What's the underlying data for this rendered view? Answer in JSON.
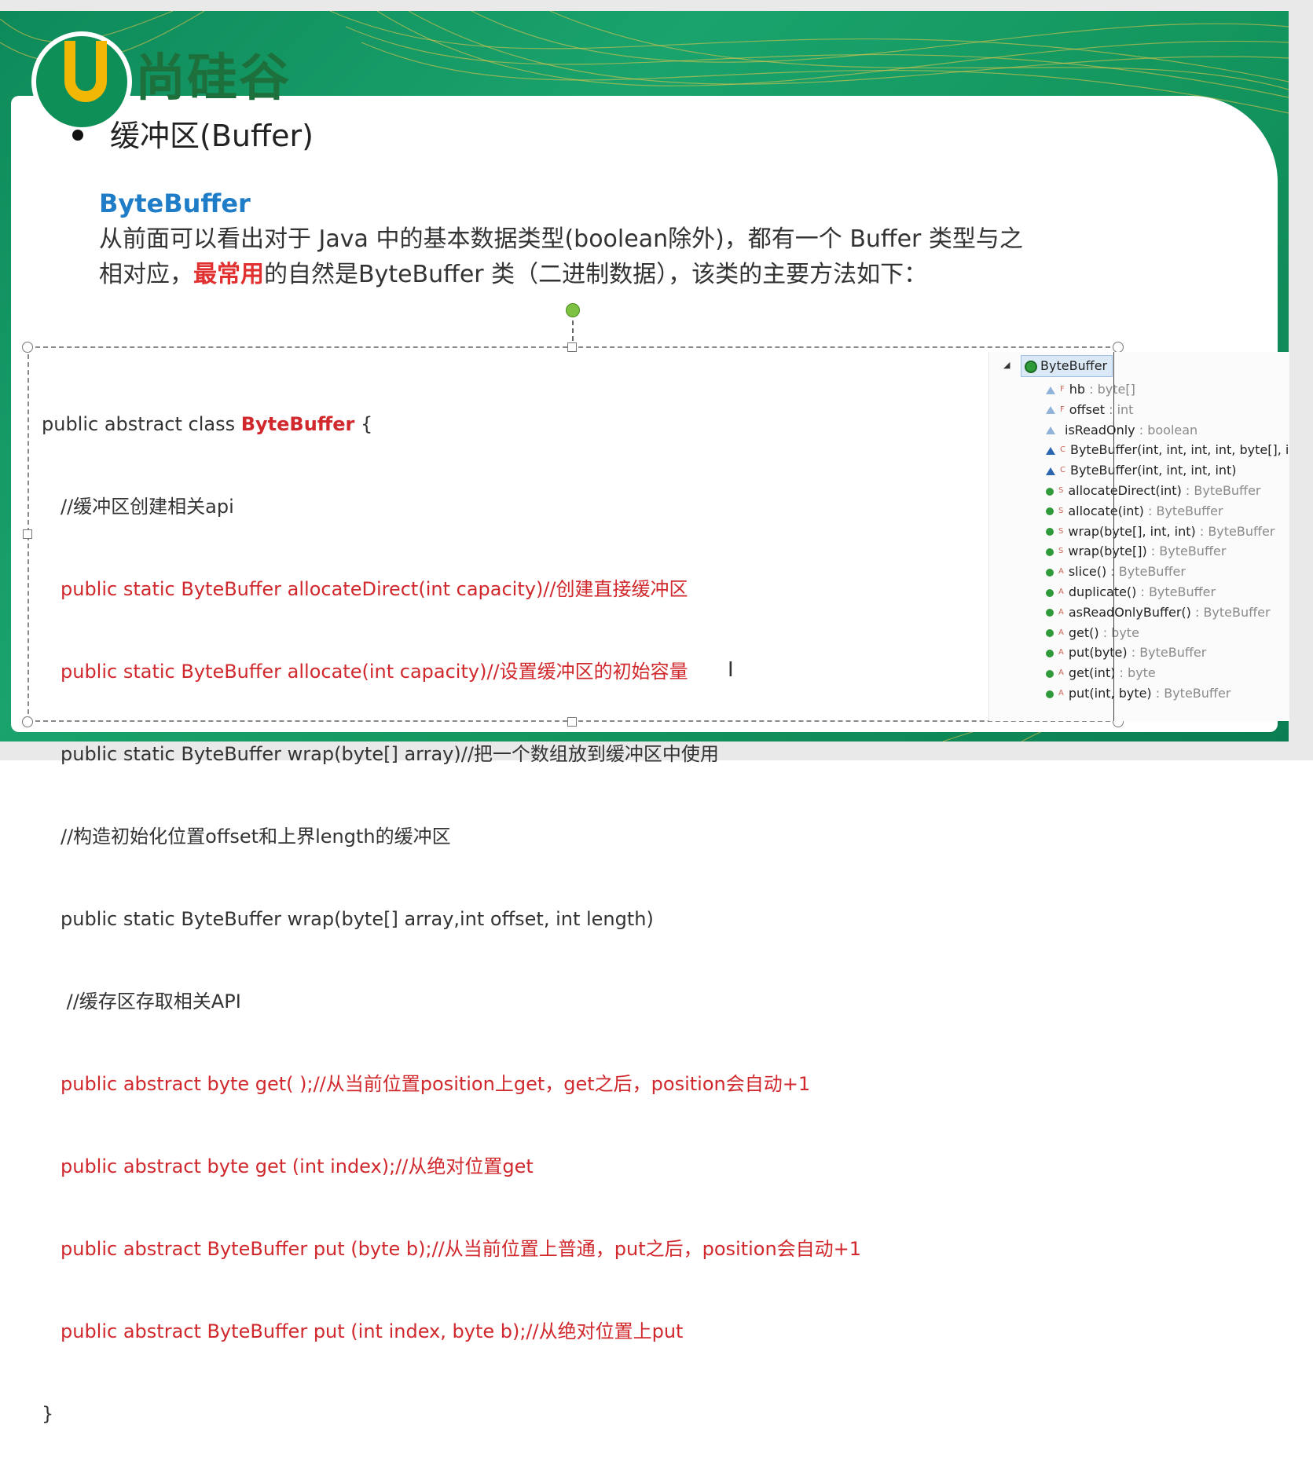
{
  "logo": {
    "letter": "U",
    "brand": "尚硅谷"
  },
  "slide": {
    "bullet_title": "缓冲区(Buffer)",
    "subtitle": "ByteBuffer",
    "para_line1": "从前面可以看出对于 Java 中的基本数据类型(boolean除外)，都有一个 Buffer 类型与之",
    "para_line2_a": "相对应，",
    "para_line2_em": "最常用",
    "para_line2_b": "的自然是ByteBuffer 类（二进制数据），该类的主要方法如下："
  },
  "code": {
    "decl_prefix": "public abstract class ",
    "decl_class": "ByteBuffer",
    "decl_suffix": " {",
    "lines": [
      "//缓冲区创建相关api",
      "public static ByteBuffer allocateDirect(int capacity)//创建直接缓冲区",
      "public static ByteBuffer allocate(int capacity)//设置缓冲区的初始容量",
      "public static ByteBuffer wrap(byte[] array)//把一个数组放到缓冲区中使用",
      "//构造初始化位置offset和上界length的缓冲区",
      "public static ByteBuffer wrap(byte[] array,int offset, int length)",
      " //缓存区存取相关API",
      "public abstract byte get( );//从当前位置position上get，get之后，position会自动+1",
      "public abstract byte get (int index);//从绝对位置get",
      "public abstract ByteBuffer put (byte b);//从当前位置上普通，put之后，position会自动+1",
      "public abstract ByteBuffer put (int index, byte b);//从绝对位置上put"
    ],
    "close": "}"
  },
  "outline": {
    "root": "ByteBuffer",
    "items": [
      {
        "sup": "F",
        "name": "hb",
        "type": " : byte[]",
        "icon": "tri-o"
      },
      {
        "sup": "F",
        "name": "offset",
        "type": " : int",
        "icon": "tri-o"
      },
      {
        "sup": "",
        "name": "isReadOnly",
        "type": " : boolean",
        "icon": "tri-o"
      },
      {
        "sup": "C",
        "name": "ByteBuffer(int, int, int, int, byte[], i",
        "type": "",
        "icon": "tri"
      },
      {
        "sup": "C",
        "name": "ByteBuffer(int, int, int, int)",
        "type": "",
        "icon": "tri"
      },
      {
        "sup": "S",
        "name": "allocateDirect(int)",
        "type": " : ByteBuffer",
        "icon": "dot"
      },
      {
        "sup": "S",
        "name": "allocate(int)",
        "type": " : ByteBuffer",
        "icon": "dot"
      },
      {
        "sup": "S",
        "name": "wrap(byte[], int, int)",
        "type": " : ByteBuffer",
        "icon": "dot"
      },
      {
        "sup": "S",
        "name": "wrap(byte[])",
        "type": " : ByteBuffer",
        "icon": "dot"
      },
      {
        "sup": "A",
        "name": "slice()",
        "type": " : ByteBuffer",
        "icon": "dot"
      },
      {
        "sup": "A",
        "name": "duplicate()",
        "type": " : ByteBuffer",
        "icon": "dot"
      },
      {
        "sup": "A",
        "name": "asReadOnlyBuffer()",
        "type": " : ByteBuffer",
        "icon": "dot"
      },
      {
        "sup": "A",
        "name": "get()",
        "type": " : byte",
        "icon": "dot"
      },
      {
        "sup": "A",
        "name": "put(byte)",
        "type": " : ByteBuffer",
        "icon": "dot"
      },
      {
        "sup": "A",
        "name": "get(int)",
        "type": " : byte",
        "icon": "dot"
      },
      {
        "sup": "A",
        "name": "put(int, byte)",
        "type": " : ByteBuffer",
        "icon": "dot"
      }
    ]
  },
  "colors": {
    "accent_green": "#14975f",
    "heading_blue": "#1f7cc7",
    "emphasis_red": "#d0282c"
  }
}
